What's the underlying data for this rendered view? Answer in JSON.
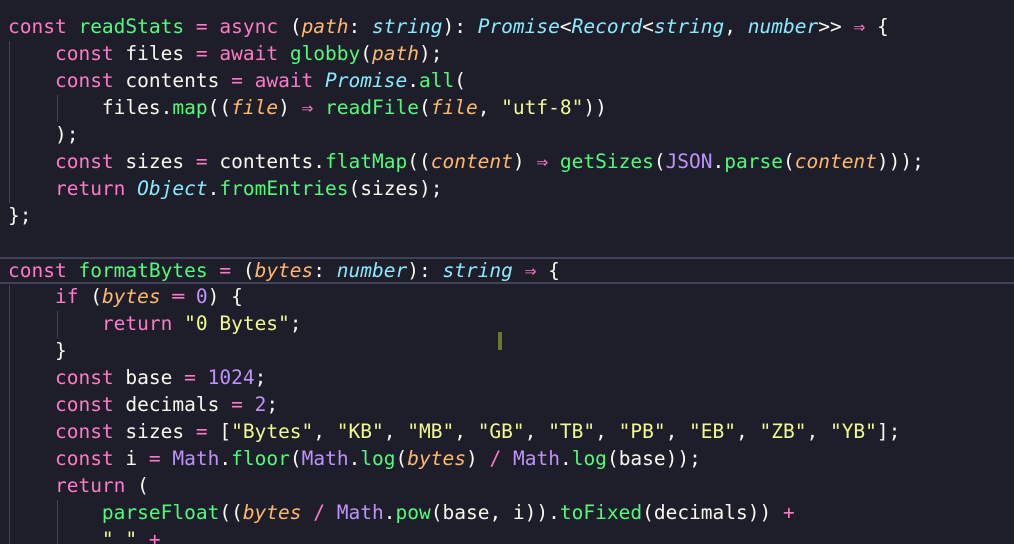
{
  "editor": {
    "lines": [
      "const readStats = async (path: string): Promise<Record<string, number>> ⇒ {",
      "    const files = await globby(path);",
      "    const contents = await Promise.all(",
      "        files.map((file) ⇒ readFile(file, \"utf-8\"))",
      "    );",
      "    const sizes = contents.flatMap((content) ⇒ getSizes(JSON.parse(content)));",
      "    return Object.fromEntries(sizes);",
      "};",
      "",
      "const formatBytes = (bytes: number): string ⇒ {",
      "    if (bytes ═ 0) {",
      "        return \"0 Bytes\";",
      "    }",
      "    const base = 1024;",
      "    const decimals = 2;",
      "    const sizes = [\"Bytes\", \"KB\", \"MB\", \"GB\", \"TB\", \"PB\", \"EB\", \"ZB\", \"YB\"];",
      "    const i = Math.floor(Math.log(bytes) / Math.log(base));",
      "    return (",
      "        parseFloat((bytes / Math.pow(base, i)).toFixed(decimals)) +",
      "        \" \" +"
    ],
    "current_line_index": 9,
    "colors": {
      "background": "#1e1e2a",
      "keyword": "#ff79c6",
      "identifier": "#50fa7b",
      "param": "#ffb86c",
      "type": "#8be9fd",
      "string": "#f1fa8c",
      "number": "#bd93f9",
      "error_underline": "#ff5555"
    }
  }
}
